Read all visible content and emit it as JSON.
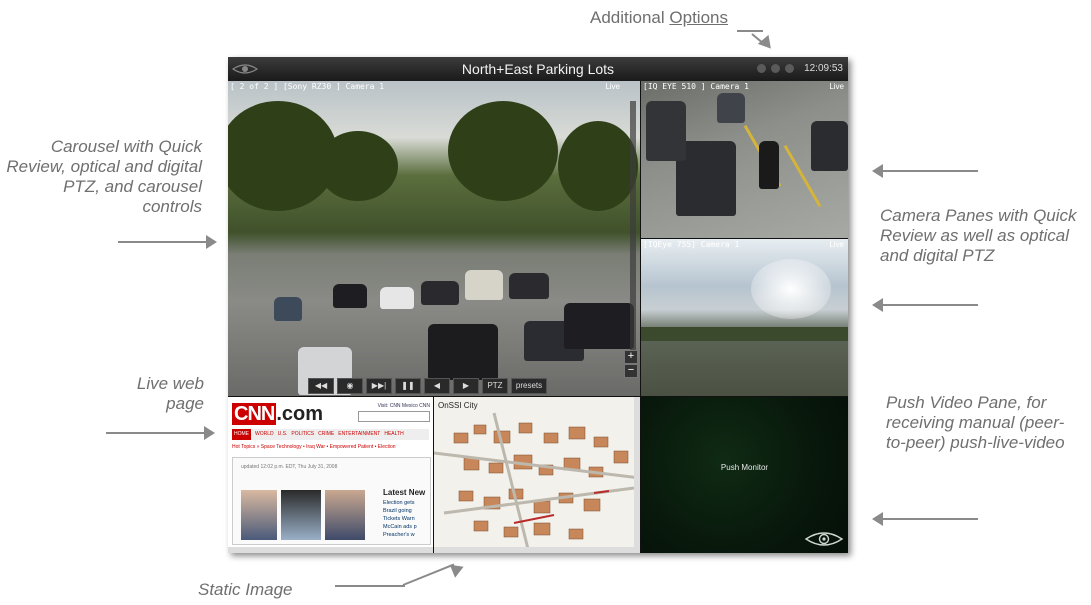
{
  "window": {
    "title": "North+East Parking Lots",
    "clock": "12:09:53"
  },
  "annotations": {
    "additional_options": [
      "Additional ",
      "Options"
    ],
    "carousel": "Carousel with Quick Review, optical and digital PTZ, and carousel controls",
    "camera_panes": "Camera Panes with Quick Review as well as optical and digital PTZ",
    "live_web_page": "Live web page",
    "push_video_pane": "Push Video Pane, for receiving manual (peer-to-peer) push-live-video",
    "static_image": "Static Image"
  },
  "main_camera": {
    "label": "[ 2 of 2 ] [Sony RZ30 ] Camera 1",
    "live": "Live",
    "controls": [
      "◀◀",
      "◉",
      "▶▶|",
      "❚❚",
      "◀",
      "▶",
      "PTZ",
      "presets"
    ],
    "zoom_in": "+",
    "zoom_out": "−"
  },
  "camera_2": {
    "label": "[IQ EYE 510 ] Camera 1",
    "live": "Live"
  },
  "camera_3": {
    "label": "[IQEye 755] Camera 1",
    "live": "Live"
  },
  "web_page": {
    "logo": "CNN",
    "logo_suffix": ".com",
    "visit": "Visit: CNN Mexico  CNN",
    "nav": [
      "HOME",
      "WORLD",
      "U.S.",
      "POLITICS",
      "CRIME",
      "ENTERTAINMENT",
      "HEALTH"
    ],
    "hot_topics": "Hot Topics » Space Technology • Iraq War • Empowered Patient • Election",
    "updated": "updated 12:02 p.m. EDT, Thu July 31, 2008",
    "latest_heading": "Latest New",
    "latest_items": [
      "Election gets",
      "Brazil going",
      "Tickets Warn",
      "McCain ads p",
      "Preacher's w"
    ]
  },
  "map_pane": {
    "title": "OnSSI City"
  },
  "push_pane": {
    "label": "Push Monitor"
  },
  "colors": {
    "accent": "#cc0000",
    "window_bg": "#111111",
    "annotation": "#6f6f6f"
  }
}
